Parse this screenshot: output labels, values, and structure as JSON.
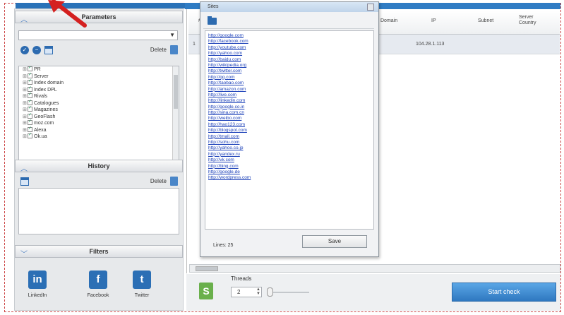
{
  "left_panel": {
    "parameters_title": "Parameters",
    "delete_label": "Delete",
    "tree_items": [
      "PR",
      "Server",
      "Index domain",
      "Index DPL",
      "Rivals",
      "Catalogues",
      "Magazines",
      "GeoFlash",
      "moz.com",
      "Alexa",
      "Ok.ua"
    ],
    "history_title": "History",
    "history_delete_label": "Delete",
    "filters_title": "Filters",
    "social": [
      {
        "glyph": "in",
        "label": "LinkedIn"
      },
      {
        "glyph": "f",
        "label": "Facebook"
      },
      {
        "glyph": "t",
        "label": "Twitter"
      }
    ]
  },
  "grid": {
    "columns": [
      "#",
      "Domain",
      "IP",
      "Subnet",
      "Server Country"
    ],
    "selected_row": {
      "marker": "1",
      "ip": "104.28.1.113"
    }
  },
  "bottom": {
    "s_label": "S",
    "threads_label": "Threads",
    "threads_value": "2",
    "start_label": "Start check"
  },
  "dialog": {
    "title": "Sites",
    "sites": [
      "http://google.com",
      "http://facebook.com",
      "http://youtube.com",
      "http://yahoo.com",
      "http://baidu.com",
      "http://wikipedia.org",
      "http://twitter.com",
      "http://qq.com",
      "http://taobao.com",
      "http://amazon.com",
      "http://live.com",
      "http://linkedin.com",
      "http://google.co.in",
      "http://sina.com.cn",
      "http://weibo.com",
      "http://hao123.com",
      "http://blogspot.com",
      "http://tmall.com",
      "http://sohu.com",
      "http://yahoo.co.jp",
      "http://yandex.ru",
      "http://vk.com",
      "http://bing.com",
      "http://google.de",
      "http://wordpress.com"
    ],
    "lines_label": "Lines: 25",
    "save_label": "Save"
  },
  "colors": {
    "accent": "#2f7cc4",
    "start_button": "#2f78c0",
    "s_icon": "#6ab04c",
    "annotation_arrow": "#d42020"
  }
}
